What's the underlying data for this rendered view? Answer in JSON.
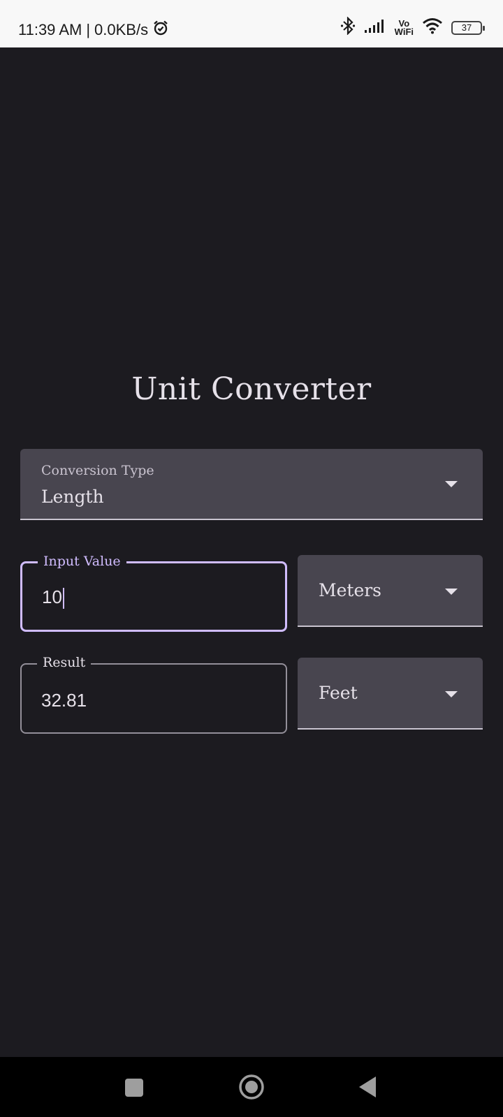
{
  "status_bar": {
    "time": "11:39 AM",
    "separator": "|",
    "net_speed": "0.0KB/s",
    "vowifi_top": "Vo",
    "vowifi_bottom": "WiFi",
    "battery": "37",
    "icons": [
      "alarm-icon",
      "bluetooth-icon",
      "signal-icon",
      "wifi-icon",
      "battery-icon"
    ]
  },
  "app": {
    "title": "Unit Converter",
    "conversion_type": {
      "label": "Conversion Type",
      "value": "Length"
    },
    "input": {
      "label": "Input Value",
      "value": "10",
      "unit": "Meters"
    },
    "result": {
      "label": "Result",
      "value": "32.81",
      "unit": "Feet"
    }
  },
  "nav_bar": {
    "buttons": [
      "recents-button",
      "home-button",
      "back-button"
    ]
  },
  "colors": {
    "background": "#1c1b20",
    "surface": "#48454f",
    "accent": "#d0bcff",
    "text": "#e6e1e9"
  }
}
